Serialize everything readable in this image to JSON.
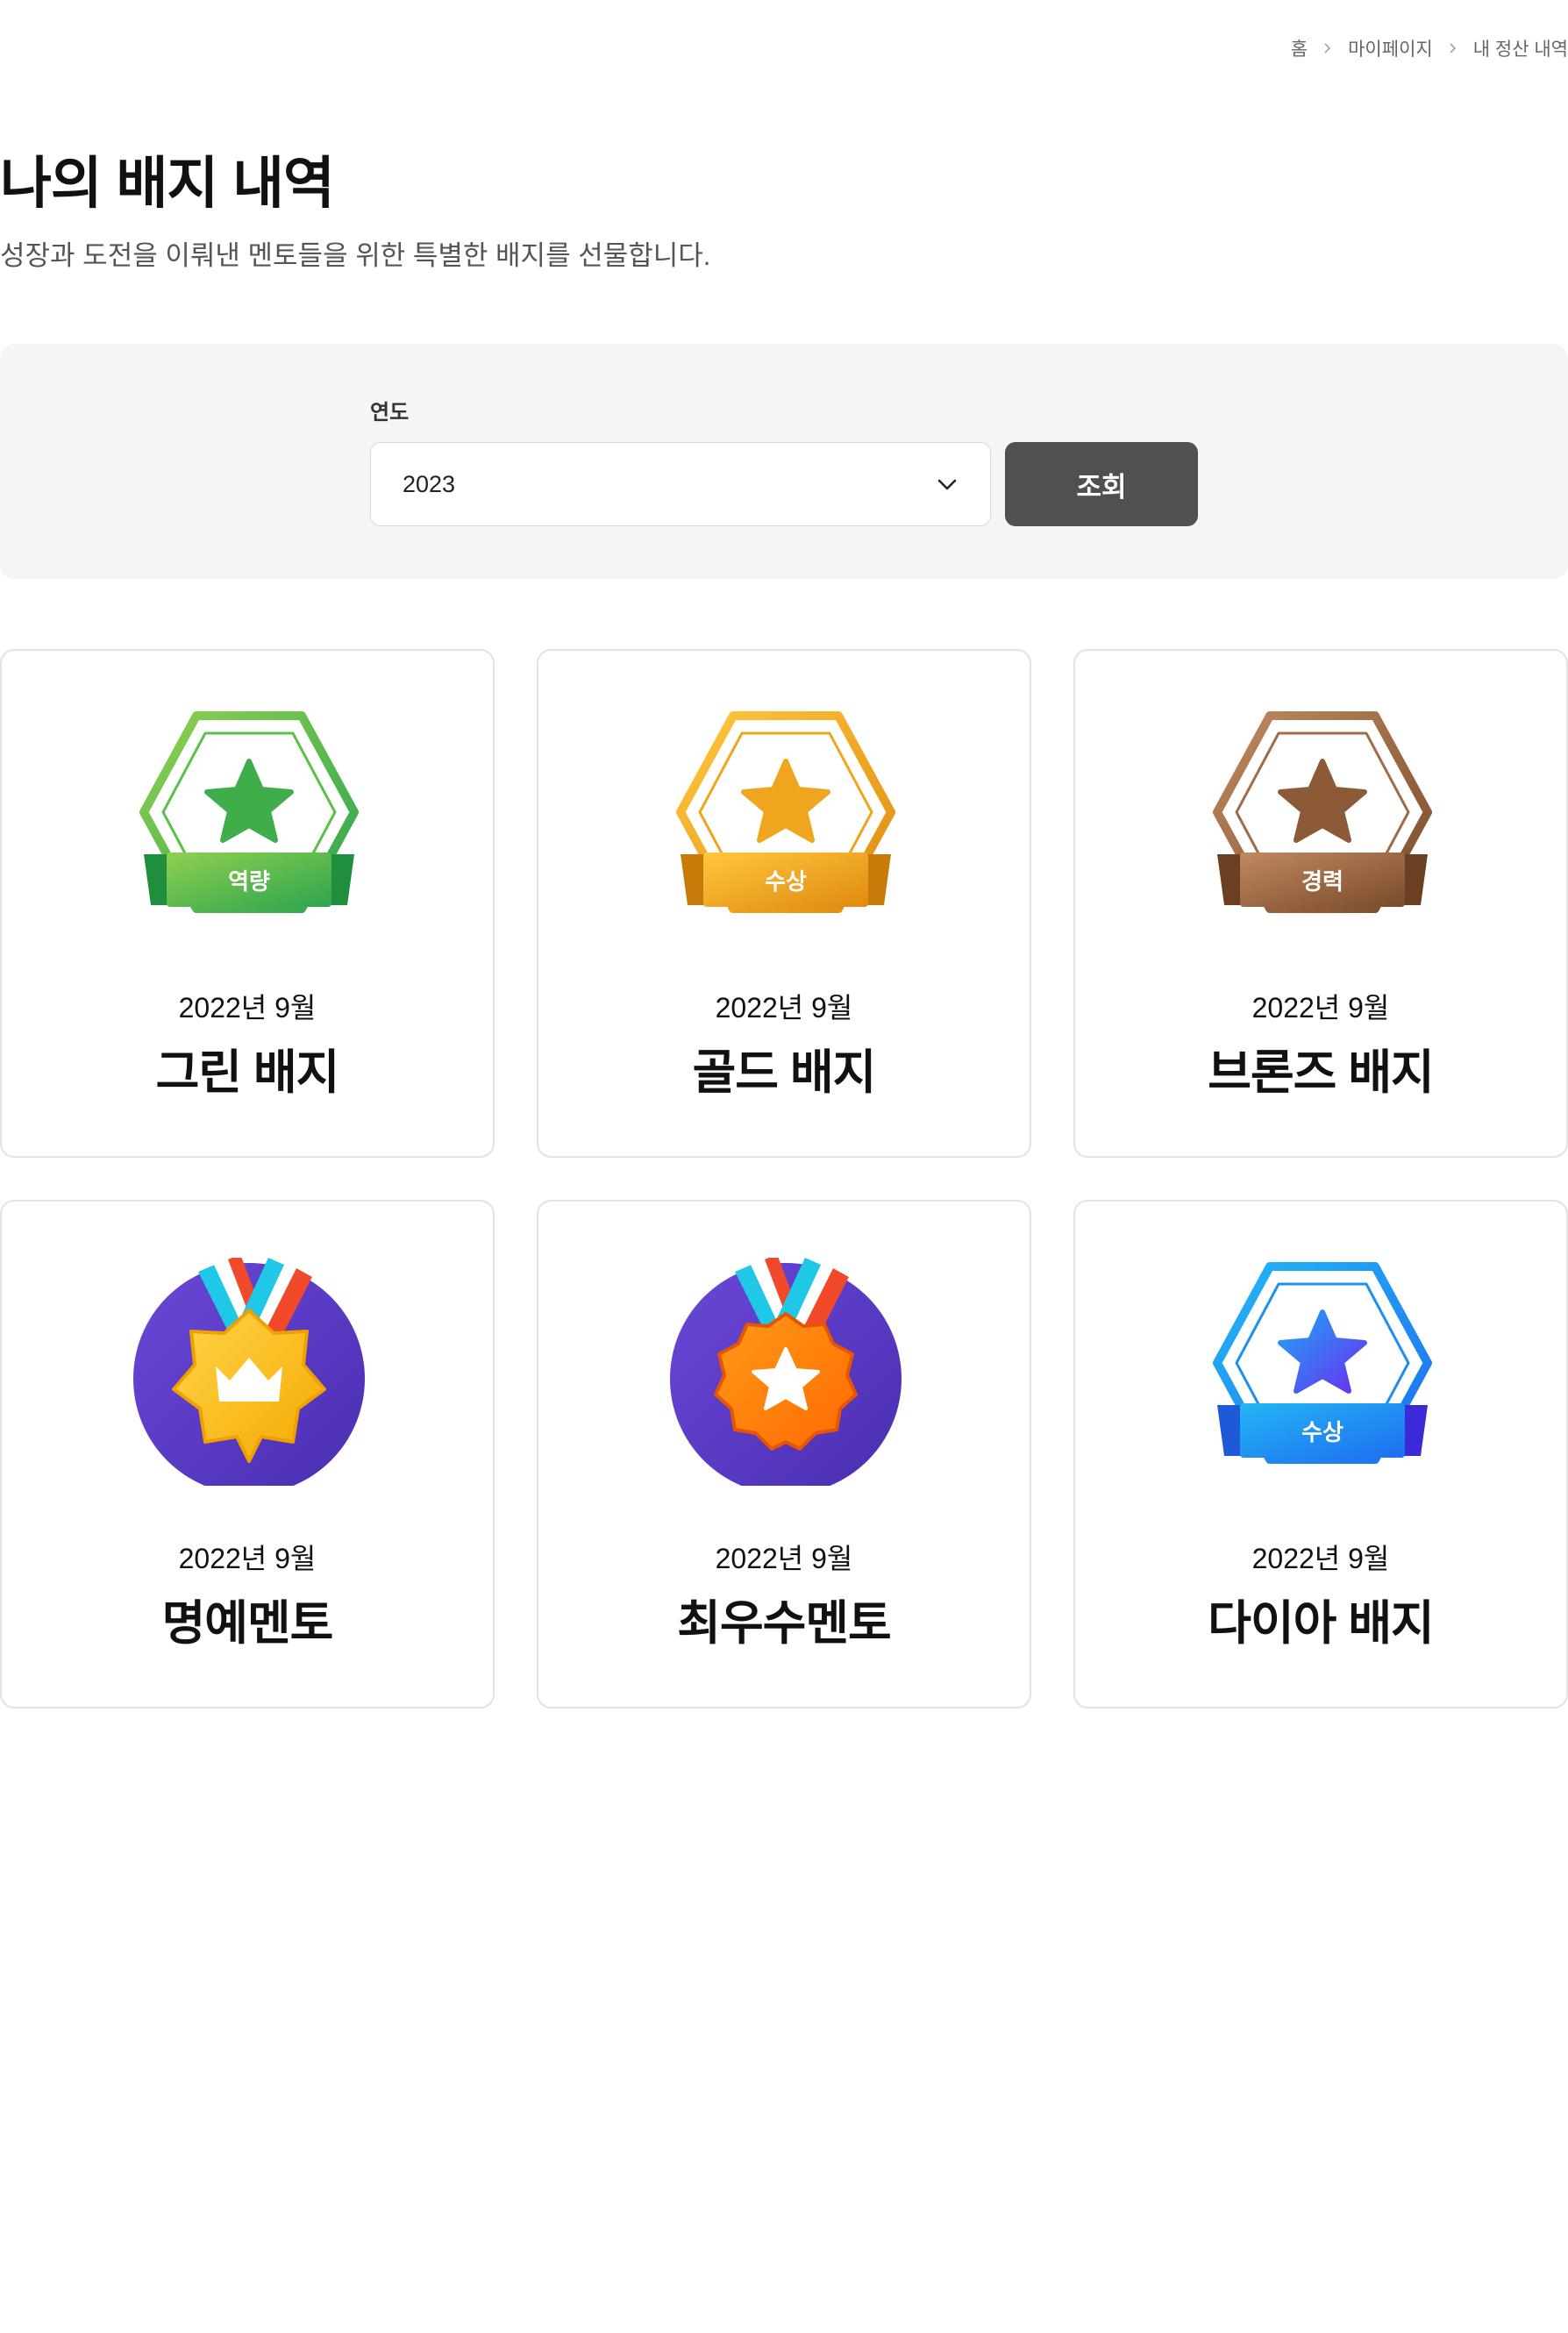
{
  "breadcrumb": {
    "items": [
      "홈",
      "마이페이지",
      "내 정산 내역"
    ]
  },
  "header": {
    "title": "나의 배지 내역",
    "description": "성장과 도전을 이뤄낸 멘토들을 위한 특별한 배지를 선물합니다."
  },
  "filter": {
    "label": "연도",
    "selected_year": "2023",
    "search_label": "조회"
  },
  "badges": [
    {
      "date": "2022년 9월",
      "name": "그린 배지",
      "ribbon": "역량",
      "style": "hexagon-star",
      "color": "#4cb84a"
    },
    {
      "date": "2022년 9월",
      "name": "골드 배지",
      "ribbon": "수상",
      "style": "hexagon-star",
      "color": "#f0a51e"
    },
    {
      "date": "2022년 9월",
      "name": "브론즈 배지",
      "ribbon": "경력",
      "style": "hexagon-star",
      "color": "#a06c47"
    },
    {
      "date": "2022년 9월",
      "name": "명예멘토",
      "ribbon": "",
      "style": "medal-crown",
      "color": "#5a38c8"
    },
    {
      "date": "2022년 9월",
      "name": "최우수멘토",
      "ribbon": "",
      "style": "medal-star",
      "color": "#ff7a00"
    },
    {
      "date": "2022년 9월",
      "name": "다이아 배지",
      "ribbon": "수상",
      "style": "hexagon-star",
      "color": "#1e8ef0"
    }
  ]
}
